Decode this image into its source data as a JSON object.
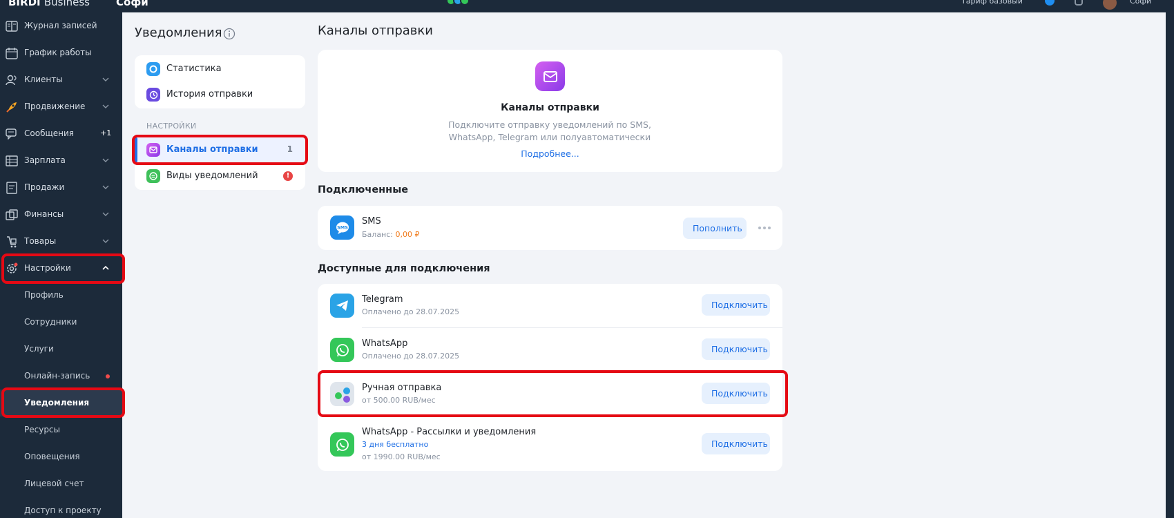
{
  "topbar": {
    "brand": "BIRDI",
    "brand_suffix": "Business",
    "branch": "Софи",
    "tariff": "Тариф базовый",
    "user": "Софи"
  },
  "sidebar": {
    "items": [
      {
        "label": "Журнал записей",
        "icon": "journal-icon"
      },
      {
        "label": "График работы",
        "icon": "calendar-icon"
      },
      {
        "label": "Клиенты",
        "icon": "clients-icon"
      },
      {
        "label": "Продвижение",
        "icon": "rocket-icon"
      },
      {
        "label": "Сообщения",
        "icon": "messages-icon",
        "badge": "+1"
      },
      {
        "label": "Зарплата",
        "icon": "salary-icon"
      },
      {
        "label": "Продажи",
        "icon": "sales-icon"
      },
      {
        "label": "Финансы",
        "icon": "finance-icon"
      },
      {
        "label": "Товары",
        "icon": "goods-icon"
      },
      {
        "label": "Настройки",
        "icon": "gear-icon"
      }
    ],
    "sub_items": [
      {
        "label": "Профиль"
      },
      {
        "label": "Сотрудники"
      },
      {
        "label": "Услуги"
      },
      {
        "label": "Онлайн-запись"
      },
      {
        "label": "Уведомления"
      },
      {
        "label": "Ресурсы"
      },
      {
        "label": "Оповещения"
      },
      {
        "label": "Лицевой счет"
      },
      {
        "label": "Доступ к проекту"
      }
    ]
  },
  "notifications_menu": {
    "title": "Уведомления",
    "items_top": [
      {
        "label": "Статистика"
      },
      {
        "label": "История отправки"
      }
    ],
    "section_label": "НАСТРОЙКИ",
    "items_settings": [
      {
        "label": "Каналы отправки",
        "count": "1"
      },
      {
        "label": "Виды уведомлений",
        "alert": "!"
      }
    ]
  },
  "main": {
    "title": "Каналы отправки",
    "hero": {
      "title": "Каналы отправки",
      "desc_line1": "Подключите отправку уведомлений по SMS,",
      "desc_line2": "WhatsApp, Telegram или полуавтоматически",
      "link": "Подробнее..."
    },
    "connected_title": "Подключенные",
    "connected": [
      {
        "name": "SMS",
        "balance_label": "Баланс:",
        "balance_value": "0,00 ₽",
        "button": "Пополнить"
      }
    ],
    "available_title": "Доступные для подключения",
    "available": [
      {
        "name": "Telegram",
        "sub": "Оплачено до 28.07.2025",
        "button": "Подключить"
      },
      {
        "name": "WhatsApp",
        "sub": "Оплачено до 28.07.2025",
        "button": "Подключить"
      },
      {
        "name": "Ручная отправка",
        "sub": "от 500.00 RUB/мес",
        "button": "Подключить"
      },
      {
        "name": "WhatsApp - Рассылки и уведомления",
        "trial": "3 дня бесплатно",
        "sub": "от 1990.00 RUB/мес",
        "button": "Подключить"
      }
    ]
  },
  "colors": {
    "sidebar_bg": "#1c2a3a",
    "accent": "#1f6fe5",
    "highlight": "#e50914",
    "sms_blue": "#1e8be8",
    "telegram_blue": "#2aa3e6",
    "whatsapp_green": "#34c759"
  }
}
